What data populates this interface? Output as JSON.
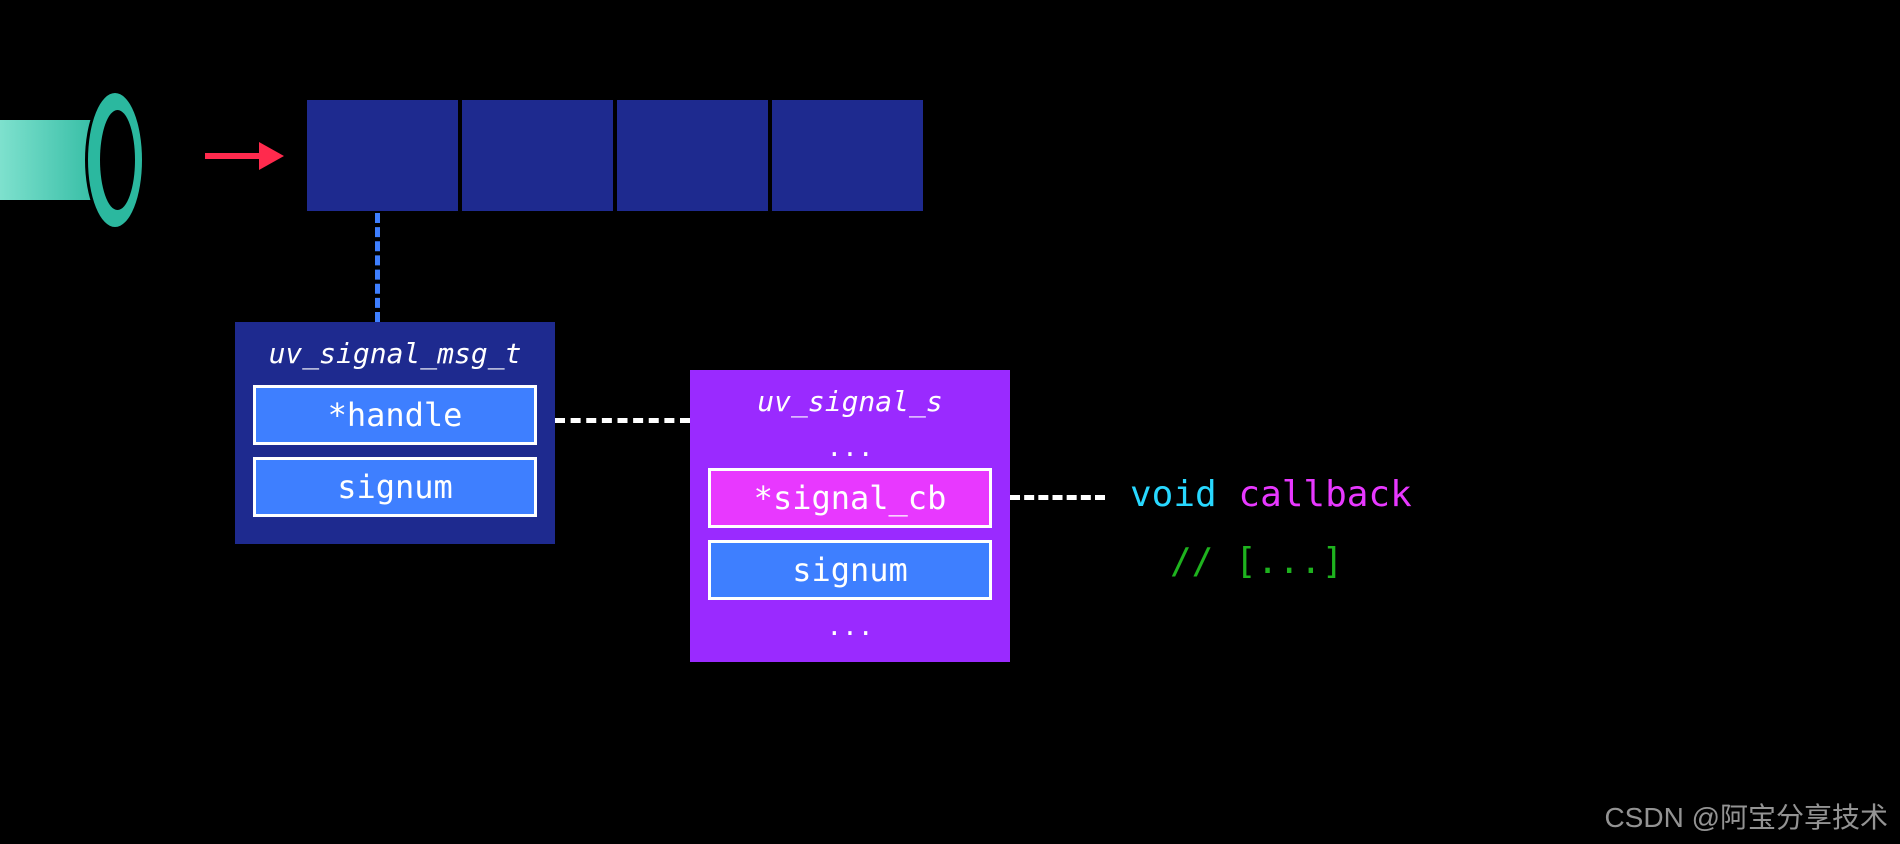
{
  "msg_struct": {
    "title": "uv_signal_msg_t",
    "field_handle": "*handle",
    "field_signum": "signum"
  },
  "signal_struct": {
    "title": "uv_signal_s",
    "dots": "...",
    "field_signal_cb": "*signal_cb",
    "field_signum": "signum"
  },
  "code": {
    "kw_void": "void",
    "kw_callback": "callback",
    "comment": "// [...]"
  },
  "watermark": "CSDN @阿宝分享技术"
}
